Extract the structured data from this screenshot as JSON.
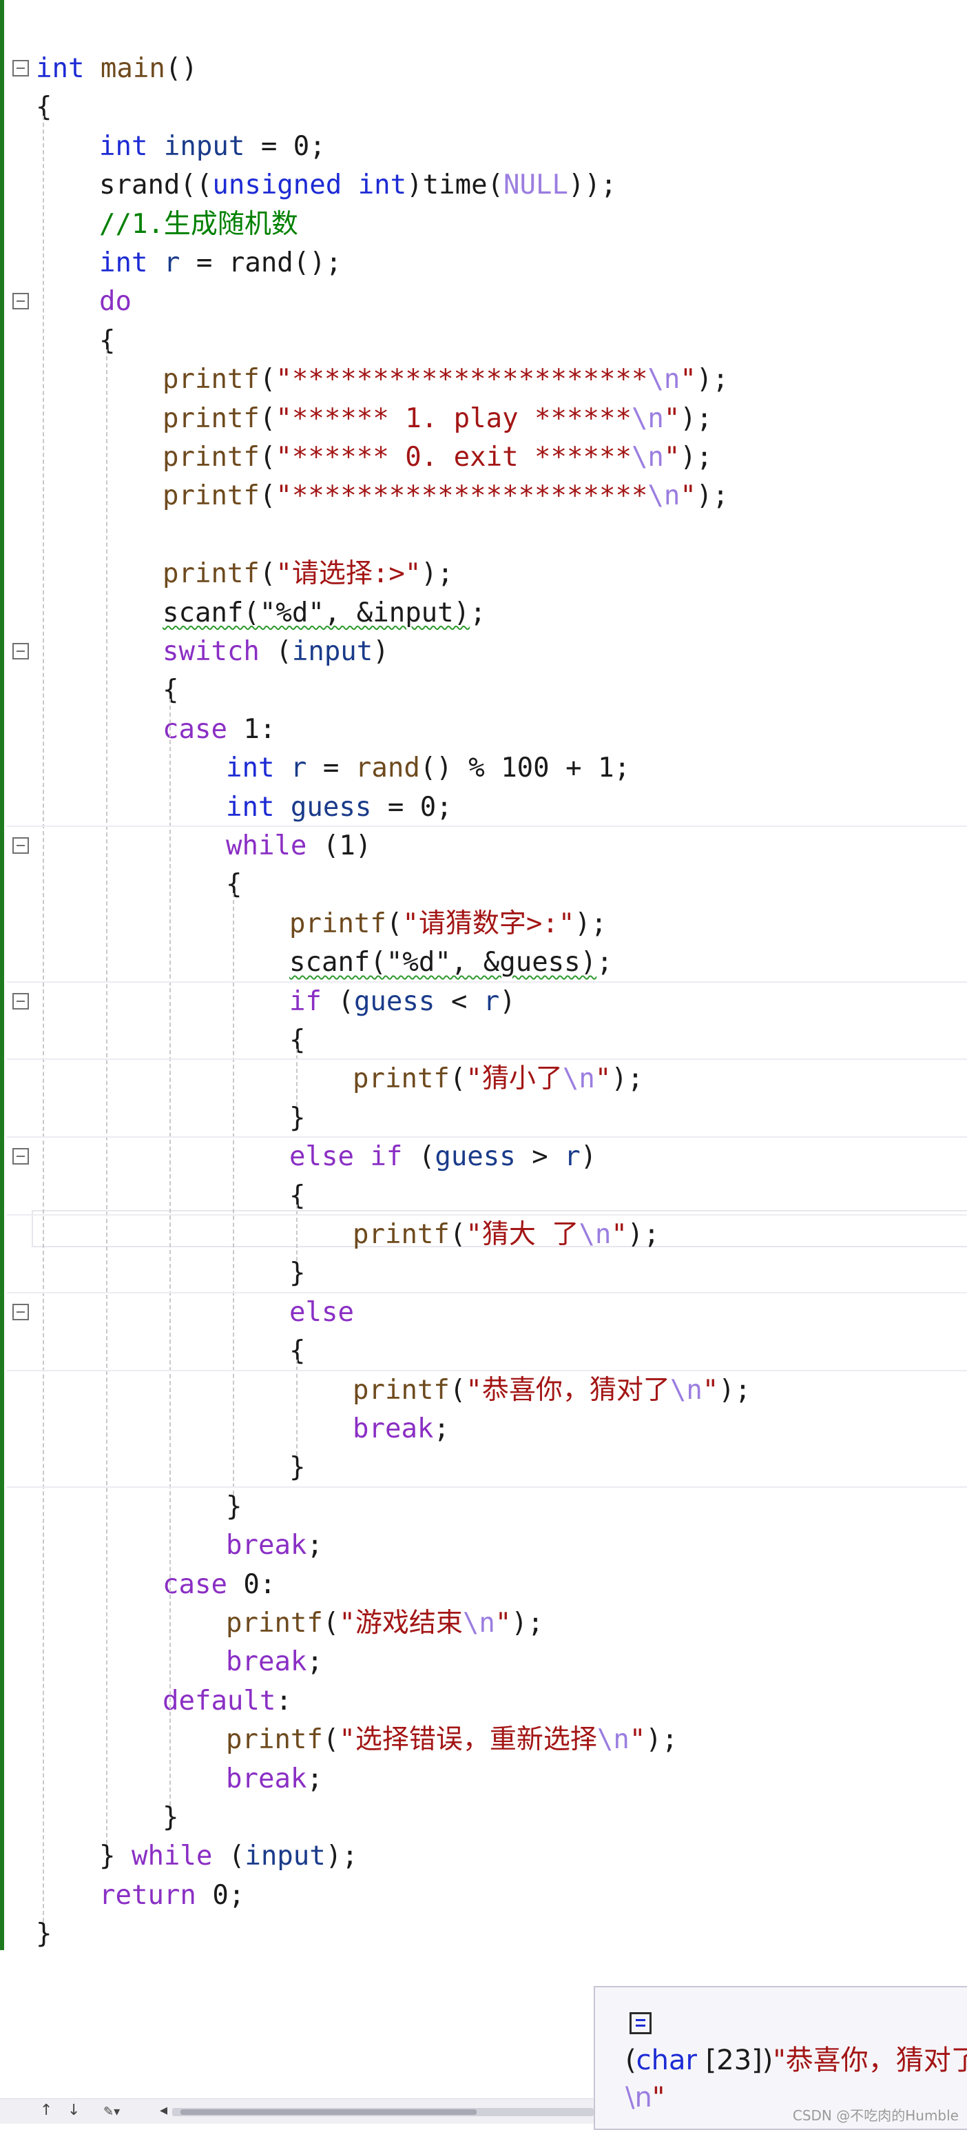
{
  "editor": {
    "lines": [
      {
        "indent": 0,
        "fold": true,
        "tokens": [
          {
            "t": "int",
            "c": "ty"
          },
          {
            "t": " main",
            "c": "fn"
          },
          {
            "t": "()",
            "c": "pl"
          }
        ]
      },
      {
        "indent": 0,
        "tokens": [
          {
            "t": "{",
            "c": "pl"
          }
        ]
      },
      {
        "indent": 1,
        "tokens": [
          {
            "t": "int",
            "c": "ty"
          },
          {
            "t": " input",
            "c": "id"
          },
          {
            "t": " = 0;",
            "c": "pl"
          }
        ]
      },
      {
        "indent": 1,
        "tokens": [
          {
            "t": "srand((",
            "c": "pl"
          },
          {
            "t": "unsigned",
            "c": "ty"
          },
          {
            "t": " ",
            "c": "pl"
          },
          {
            "t": "int",
            "c": "ty"
          },
          {
            "t": ")time(",
            "c": "pl"
          },
          {
            "t": "NULL",
            "c": "es"
          },
          {
            "t": "));",
            "c": "pl"
          }
        ]
      },
      {
        "indent": 1,
        "tokens": [
          {
            "t": "//1.生成随机数",
            "c": "cm"
          }
        ]
      },
      {
        "indent": 1,
        "tokens": [
          {
            "t": "int",
            "c": "ty"
          },
          {
            "t": " r",
            "c": "id"
          },
          {
            "t": " = rand();",
            "c": "pl"
          }
        ]
      },
      {
        "indent": 1,
        "fold": true,
        "tokens": [
          {
            "t": "do",
            "c": "kw"
          }
        ]
      },
      {
        "indent": 1,
        "tokens": [
          {
            "t": "{",
            "c": "pl"
          }
        ]
      },
      {
        "indent": 2,
        "tokens": [
          {
            "t": "printf",
            "c": "fn"
          },
          {
            "t": "(",
            "c": "pl"
          },
          {
            "t": "\"**********************",
            "c": "st"
          },
          {
            "t": "\\n",
            "c": "es"
          },
          {
            "t": "\"",
            "c": "st"
          },
          {
            "t": ");",
            "c": "pl"
          }
        ]
      },
      {
        "indent": 2,
        "tokens": [
          {
            "t": "printf",
            "c": "fn"
          },
          {
            "t": "(",
            "c": "pl"
          },
          {
            "t": "\"****** 1. play ******",
            "c": "st"
          },
          {
            "t": "\\n",
            "c": "es"
          },
          {
            "t": "\"",
            "c": "st"
          },
          {
            "t": ");",
            "c": "pl"
          }
        ]
      },
      {
        "indent": 2,
        "tokens": [
          {
            "t": "printf",
            "c": "fn"
          },
          {
            "t": "(",
            "c": "pl"
          },
          {
            "t": "\"****** 0. exit ******",
            "c": "st"
          },
          {
            "t": "\\n",
            "c": "es"
          },
          {
            "t": "\"",
            "c": "st"
          },
          {
            "t": ");",
            "c": "pl"
          }
        ]
      },
      {
        "indent": 2,
        "tokens": [
          {
            "t": "printf",
            "c": "fn"
          },
          {
            "t": "(",
            "c": "pl"
          },
          {
            "t": "\"**********************",
            "c": "st"
          },
          {
            "t": "\\n",
            "c": "es"
          },
          {
            "t": "\"",
            "c": "st"
          },
          {
            "t": ");",
            "c": "pl"
          }
        ]
      },
      {
        "indent": 0,
        "tokens": []
      },
      {
        "indent": 2,
        "tokens": [
          {
            "t": "printf",
            "c": "fn"
          },
          {
            "t": "(",
            "c": "pl"
          },
          {
            "t": "\"请选择:>\"",
            "c": "st"
          },
          {
            "t": ");",
            "c": "pl"
          }
        ]
      },
      {
        "indent": 2,
        "tokens": [
          {
            "t": "scanf(\"%d\", &input)",
            "c": "squiggle"
          },
          {
            "t": ";",
            "c": "pl"
          }
        ]
      },
      {
        "indent": 2,
        "fold": true,
        "tokens": [
          {
            "t": "switch",
            "c": "kw"
          },
          {
            "t": " (",
            "c": "pl"
          },
          {
            "t": "input",
            "c": "id"
          },
          {
            "t": ")",
            "c": "pl"
          }
        ]
      },
      {
        "indent": 2,
        "tokens": [
          {
            "t": "{",
            "c": "pl"
          }
        ]
      },
      {
        "indent": 2,
        "tokens": [
          {
            "t": "case",
            "c": "kw"
          },
          {
            "t": " 1:",
            "c": "pl"
          }
        ]
      },
      {
        "indent": 3,
        "tokens": [
          {
            "t": "int",
            "c": "ty"
          },
          {
            "t": " r",
            "c": "id"
          },
          {
            "t": " = ",
            "c": "pl"
          },
          {
            "t": "rand",
            "c": "fn"
          },
          {
            "t": "() % 100 + 1;",
            "c": "pl"
          }
        ]
      },
      {
        "indent": 3,
        "tokens": [
          {
            "t": "int",
            "c": "ty"
          },
          {
            "t": " guess",
            "c": "id"
          },
          {
            "t": " = 0;",
            "c": "pl"
          }
        ]
      },
      {
        "indent": 3,
        "fold": true,
        "tokens": [
          {
            "t": "while",
            "c": "kw"
          },
          {
            "t": " (1)",
            "c": "pl"
          }
        ]
      },
      {
        "indent": 3,
        "tokens": [
          {
            "t": "{",
            "c": "pl"
          }
        ]
      },
      {
        "indent": 4,
        "tokens": [
          {
            "t": "printf",
            "c": "fn"
          },
          {
            "t": "(",
            "c": "pl"
          },
          {
            "t": "\"请猜数字>:\"",
            "c": "st"
          },
          {
            "t": ");",
            "c": "pl"
          }
        ]
      },
      {
        "indent": 4,
        "tokens": [
          {
            "t": "scanf(\"%d\", &guess)",
            "c": "squiggle"
          },
          {
            "t": ";",
            "c": "pl"
          }
        ]
      },
      {
        "indent": 4,
        "fold": true,
        "tokens": [
          {
            "t": "if",
            "c": "kw"
          },
          {
            "t": " (",
            "c": "pl"
          },
          {
            "t": "guess",
            "c": "id"
          },
          {
            "t": " < ",
            "c": "pl"
          },
          {
            "t": "r",
            "c": "id"
          },
          {
            "t": ")",
            "c": "pl"
          }
        ]
      },
      {
        "indent": 4,
        "tokens": [
          {
            "t": "{",
            "c": "pl"
          }
        ]
      },
      {
        "indent": 5,
        "tokens": [
          {
            "t": "printf",
            "c": "fn"
          },
          {
            "t": "(",
            "c": "pl"
          },
          {
            "t": "\"猜小了",
            "c": "st"
          },
          {
            "t": "\\n",
            "c": "es"
          },
          {
            "t": "\"",
            "c": "st"
          },
          {
            "t": ");",
            "c": "pl"
          }
        ]
      },
      {
        "indent": 4,
        "tokens": [
          {
            "t": "}",
            "c": "pl"
          }
        ]
      },
      {
        "indent": 4,
        "fold": true,
        "tokens": [
          {
            "t": "else",
            "c": "kw"
          },
          {
            "t": " ",
            "c": "pl"
          },
          {
            "t": "if",
            "c": "kw"
          },
          {
            "t": " (",
            "c": "pl"
          },
          {
            "t": "guess",
            "c": "id"
          },
          {
            "t": " > ",
            "c": "pl"
          },
          {
            "t": "r",
            "c": "id"
          },
          {
            "t": ")",
            "c": "pl"
          }
        ]
      },
      {
        "indent": 4,
        "tokens": [
          {
            "t": "{",
            "c": "pl"
          }
        ]
      },
      {
        "indent": 5,
        "tokens": [
          {
            "t": "printf",
            "c": "fn"
          },
          {
            "t": "(",
            "c": "pl"
          },
          {
            "t": "\"猜大 了",
            "c": "st"
          },
          {
            "t": "\\n",
            "c": "es"
          },
          {
            "t": "\"",
            "c": "st"
          },
          {
            "t": ");",
            "c": "pl"
          }
        ]
      },
      {
        "indent": 4,
        "tokens": [
          {
            "t": "}",
            "c": "pl"
          }
        ]
      },
      {
        "indent": 4,
        "fold": true,
        "tokens": [
          {
            "t": "else",
            "c": "kw"
          }
        ]
      },
      {
        "indent": 4,
        "tokens": [
          {
            "t": "{",
            "c": "pl"
          }
        ]
      },
      {
        "indent": 5,
        "tokens": [
          {
            "t": "printf",
            "c": "fn"
          },
          {
            "t": "(",
            "c": "pl"
          },
          {
            "t": "\"恭喜你，猜对了",
            "c": "st"
          },
          {
            "t": "\\n",
            "c": "es"
          },
          {
            "t": "\"",
            "c": "st"
          },
          {
            "t": ");",
            "c": "pl"
          }
        ]
      },
      {
        "indent": 5,
        "tokens": [
          {
            "t": "break",
            "c": "kw"
          },
          {
            "t": ";",
            "c": "pl"
          }
        ]
      },
      {
        "indent": 4,
        "tokens": [
          {
            "t": "}",
            "c": "pl"
          }
        ]
      },
      {
        "indent": 3,
        "tokens": [
          {
            "t": "}",
            "c": "pl"
          }
        ]
      },
      {
        "indent": 3,
        "tokens": [
          {
            "t": "break",
            "c": "kw"
          },
          {
            "t": ";",
            "c": "pl"
          }
        ]
      },
      {
        "indent": 2,
        "tokens": [
          {
            "t": "case",
            "c": "kw"
          },
          {
            "t": " 0:",
            "c": "pl"
          }
        ]
      },
      {
        "indent": 3,
        "tokens": [
          {
            "t": "printf",
            "c": "fn"
          },
          {
            "t": "(",
            "c": "pl"
          },
          {
            "t": "\"游戏结束",
            "c": "st"
          },
          {
            "t": "\\n",
            "c": "es"
          },
          {
            "t": "\"",
            "c": "st"
          },
          {
            "t": ");",
            "c": "pl"
          }
        ]
      },
      {
        "indent": 3,
        "tokens": [
          {
            "t": "break",
            "c": "kw"
          },
          {
            "t": ";",
            "c": "pl"
          }
        ]
      },
      {
        "indent": 2,
        "tokens": [
          {
            "t": "default",
            "c": "kw"
          },
          {
            "t": ":",
            "c": "pl"
          }
        ]
      },
      {
        "indent": 3,
        "tokens": [
          {
            "t": "printf",
            "c": "fn"
          },
          {
            "t": "(",
            "c": "pl"
          },
          {
            "t": "\"选择错误，重新选择",
            "c": "st"
          },
          {
            "t": "\\n",
            "c": "es"
          },
          {
            "t": "\"",
            "c": "st"
          },
          {
            "t": ");",
            "c": "pl"
          }
        ]
      },
      {
        "indent": 3,
        "tokens": [
          {
            "t": "break",
            "c": "kw"
          },
          {
            "t": ";",
            "c": "pl"
          }
        ]
      },
      {
        "indent": 2,
        "tokens": [
          {
            "t": "}",
            "c": "pl"
          }
        ]
      },
      {
        "indent": 1,
        "tokens": [
          {
            "t": "} ",
            "c": "pl"
          },
          {
            "t": "while",
            "c": "kw"
          },
          {
            "t": " (",
            "c": "pl"
          },
          {
            "t": "input",
            "c": "id"
          },
          {
            "t": ");",
            "c": "pl"
          }
        ]
      },
      {
        "indent": 1,
        "tokens": [
          {
            "t": "return",
            "c": "kw"
          },
          {
            "t": " 0;",
            "c": "pl"
          }
        ]
      },
      {
        "indent": 0,
        "tokens": [
          {
            "t": "}",
            "c": "pl"
          }
        ]
      }
    ]
  },
  "tooltip": {
    "icon": "enum-member-icon",
    "type_prefix_open": "(",
    "type_keyword": "char",
    "type_suffix": " [23])",
    "value": "\"恭喜你，猜对了",
    "escape": "\\n",
    "close_quote": "\""
  },
  "status_bar": {
    "up_icon": "↑",
    "down_icon": "↓",
    "brush_icon": "brush-dropdown-icon",
    "scroll_left_icon": "◂"
  },
  "watermark": "CSDN @不吃肉的Humble",
  "colors": {
    "keyword": "#8a2fc4",
    "type": "#1d2bd4",
    "identifier": "#1a3b8a",
    "function": "#6e4a1e",
    "string": "#a31515",
    "escape": "#9b7de0",
    "comment": "#008000",
    "change_bar": "#1f7a1f"
  }
}
